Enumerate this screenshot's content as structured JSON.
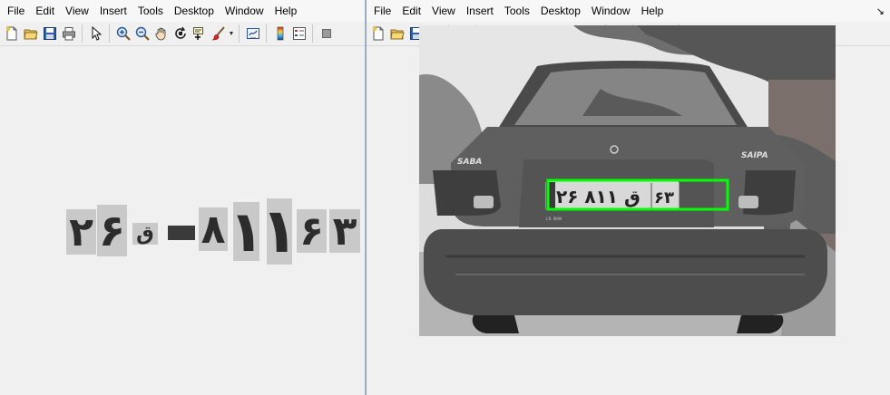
{
  "left_window": {
    "menu": [
      "File",
      "Edit",
      "View",
      "Insert",
      "Tools",
      "Desktop",
      "Window",
      "Help"
    ],
    "segmented_characters": [
      "۲",
      "۶",
      "ق",
      "-",
      "۸",
      "۱",
      "۱",
      "۶",
      "۳"
    ]
  },
  "right_window": {
    "menu": [
      "File",
      "Edit",
      "View",
      "Insert",
      "Tools",
      "Desktop",
      "Window",
      "Help"
    ],
    "corner_icon": "dock-arrow-icon",
    "photo": {
      "car_badge_left": "SABA",
      "car_badge_right": "SAIPA",
      "plate_text": "۲۶ ق ۸۱۱",
      "plate_region": "۶۳",
      "plate_country": "I.R. IRAN",
      "detection_box_color": "#00ff00"
    }
  },
  "toolbar_icons": [
    "new-figure-icon",
    "open-icon",
    "save-icon",
    "print-icon",
    "pointer-icon",
    "zoom-in-icon",
    "zoom-out-icon",
    "pan-hand-icon",
    "rotate-3d-icon",
    "data-cursor-icon",
    "brush-icon",
    "link-plot-icon",
    "colorbar-icon",
    "legend-icon",
    "hide-plot-tools-icon",
    "show-plot-tools-icon"
  ]
}
